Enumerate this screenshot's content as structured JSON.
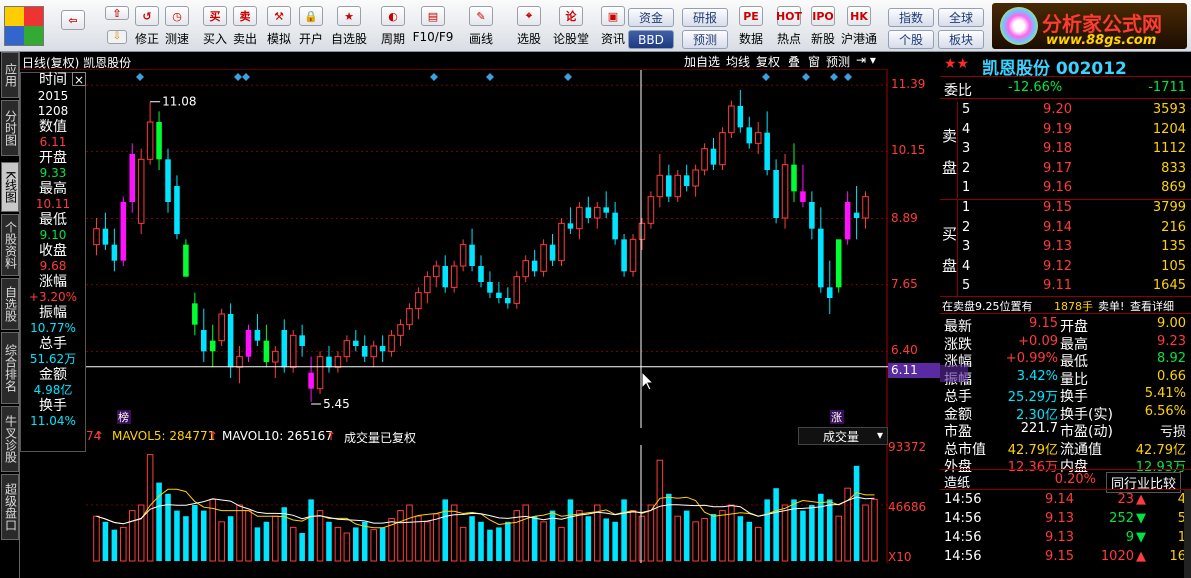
{
  "toolbar": {
    "buttons": [
      {
        "icon": "back-arrow-icon",
        "label": ""
      },
      {
        "icon": "up-arrow-icon",
        "label": ""
      },
      {
        "icon": "restore-icon",
        "label": "修正"
      },
      {
        "icon": "clock-icon",
        "label": "测速"
      },
      {
        "icon": "buy-icon",
        "label": "买入",
        "glyph": "买"
      },
      {
        "icon": "sell-icon",
        "label": "卖出",
        "glyph": "卖"
      },
      {
        "icon": "hammer-icon",
        "label": "模拟"
      },
      {
        "icon": "lock-icon",
        "label": "开户"
      },
      {
        "icon": "star-icon",
        "label": "自选股"
      },
      {
        "icon": "period-icon",
        "label": "周期"
      },
      {
        "icon": "f10-icon",
        "label": "F10/F9"
      },
      {
        "icon": "pen-icon",
        "label": "画线"
      },
      {
        "icon": "select-stock-icon",
        "label": "选股"
      },
      {
        "icon": "forum-icon",
        "label": "论股堂",
        "glyph": "论"
      },
      {
        "icon": "news-icon",
        "label": "资讯"
      },
      {
        "icon": "data-icon",
        "label": "数据",
        "glyph": "PE"
      },
      {
        "icon": "hot-icon",
        "label": "热点",
        "glyph": "HOT"
      },
      {
        "icon": "ipo-icon",
        "label": "新股",
        "glyph": "IPO"
      },
      {
        "icon": "hk-connect-icon",
        "label": "沪港通",
        "glyph": "HK"
      }
    ],
    "pills": [
      "资金",
      "研报",
      "指数",
      "全球",
      "BBD",
      "预测",
      "个股",
      "板块"
    ],
    "brand": {
      "title": "分析家公式网",
      "url": "www.88gs.com"
    }
  },
  "sidetabs": [
    "应用",
    "分时图",
    "K线图",
    "个股资料",
    "自选股",
    "综合排名",
    "牛叉诊股",
    "超级盘口"
  ],
  "chart": {
    "name": "日线(复权)  凯恩股份",
    "buttons": [
      "加自选",
      "均线",
      "复权",
      "叠",
      "窗",
      "预测"
    ],
    "high_label": "11.08",
    "low_label": "5.45",
    "cursor_price": "6.11",
    "axis": [
      "11.39",
      "10.15",
      "8.89",
      "7.65",
      "6.40"
    ],
    "marker_left": "榜",
    "marker_right": "涨"
  },
  "info": {
    "items": [
      {
        "label": "时间",
        "value": "2015",
        "color": "#ffffff"
      },
      {
        "label": "",
        "value": "1208",
        "color": "#ffffff"
      },
      {
        "label": "数值",
        "value": "6.11",
        "color": "#ff3b3b"
      },
      {
        "label": "开盘",
        "value": "9.33",
        "color": "#00e640"
      },
      {
        "label": "最高",
        "value": "10.11",
        "color": "#ff3b3b"
      },
      {
        "label": "最低",
        "value": "9.10",
        "color": "#00e640"
      },
      {
        "label": "收盘",
        "value": "9.68",
        "color": "#ff3b3b"
      },
      {
        "label": "涨幅",
        "value": "+3.20%",
        "color": "#ff3b3b"
      },
      {
        "label": "振幅",
        "value": "10.77%",
        "color": "#00e5ff"
      },
      {
        "label": "总手",
        "value": "51.62万",
        "color": "#00e5ff"
      },
      {
        "label": "金额",
        "value": "4.98亿",
        "color": "#00e5ff"
      },
      {
        "label": "换手",
        "value": "11.04%",
        "color": "#00e5ff"
      }
    ]
  },
  "volume": {
    "prefix": "74",
    "mavol5": "MAVOL5: 284771",
    "mavol10": "MAVOL10: 265167",
    "note": "成交量已复权",
    "selector": "成交量",
    "axis": [
      "93372",
      "46686"
    ],
    "unit": "X10"
  },
  "quote": {
    "title": "凯恩股份 002012",
    "wb": {
      "label": "委比",
      "pct": "-12.66%",
      "diff": "-1711"
    },
    "sell_label": "卖盘",
    "buy_label": "买盘",
    "sells": [
      {
        "n": "5",
        "p": "9.20",
        "v": "3593"
      },
      {
        "n": "4",
        "p": "9.19",
        "v": "1204"
      },
      {
        "n": "3",
        "p": "9.18",
        "v": "1112"
      },
      {
        "n": "2",
        "p": "9.17",
        "v": "833"
      },
      {
        "n": "1",
        "p": "9.16",
        "v": "869"
      }
    ],
    "buys": [
      {
        "n": "1",
        "p": "9.15",
        "v": "3799"
      },
      {
        "n": "2",
        "p": "9.14",
        "v": "216"
      },
      {
        "n": "3",
        "p": "9.13",
        "v": "135"
      },
      {
        "n": "4",
        "p": "9.12",
        "v": "105"
      },
      {
        "n": "5",
        "p": "9.11",
        "v": "1645"
      }
    ],
    "notice": {
      "text": "在卖盘9.25位置有",
      "qty": "1878手",
      "tag": "卖单!",
      "link": "查看详细"
    },
    "stats": [
      {
        "l1": "最新",
        "v1": "9.15",
        "c1": "#ff3b3b",
        "l2": "开盘",
        "v2": "9.00",
        "c2": "#ffd200"
      },
      {
        "l1": "涨跌",
        "v1": "+0.09",
        "c1": "#ff3b3b",
        "l2": "最高",
        "v2": "9.23",
        "c2": "#ff3b3b"
      },
      {
        "l1": "涨幅",
        "v1": "+0.99%",
        "c1": "#ff3b3b",
        "l2": "最低",
        "v2": "8.92",
        "c2": "#00e640"
      },
      {
        "l1": "振幅",
        "v1": "3.42%",
        "c1": "#00e5ff",
        "l2": "量比",
        "v2": "0.66",
        "c2": "#ffd200"
      },
      {
        "l1": "总手",
        "v1": "25.29万",
        "c1": "#00e5ff",
        "l2": "换手",
        "v2": "5.41%",
        "c2": "#ffd200"
      },
      {
        "l1": "金额",
        "v1": "2.30亿",
        "c1": "#00e5ff",
        "l2": "换手(实)",
        "v2": "6.56%",
        "c2": "#ffd200"
      },
      {
        "l1": "市盈",
        "v1": "221.7",
        "c1": "#ffffff",
        "l2": "市盈(动)",
        "v2": "亏损",
        "c2": "#ffffff"
      },
      {
        "l1": "总市值",
        "v1": "42.79亿",
        "c1": "#ffd200",
        "l2": "流通值",
        "v2": "42.79亿",
        "c2": "#ffd200"
      },
      {
        "l1": "外盘",
        "v1": "12.36万",
        "c1": "#ff3b3b",
        "l2": "内盘",
        "v2": "12.93万",
        "c2": "#00e640"
      }
    ],
    "industry": {
      "name": "造纸",
      "pct": "0.20%",
      "link": "同行业比较"
    },
    "ticks": [
      {
        "t": "14:56",
        "p": "9.14",
        "v": "23",
        "dir": "up",
        "n": "4"
      },
      {
        "t": "14:56",
        "p": "9.13",
        "v": "252",
        "dir": "down",
        "n": "5"
      },
      {
        "t": "14:56",
        "p": "9.13",
        "v": "9",
        "dir": "down",
        "n": "1"
      },
      {
        "t": "14:56",
        "p": "9.15",
        "v": "1020",
        "dir": "up",
        "n": "16"
      }
    ]
  },
  "colors": {
    "up": "#ff3b3b",
    "down": "#00e5ff",
    "bigup": "#ff10ff",
    "bigdown": "#00ff30",
    "grid": "#7a0000",
    "ma": "#ffffff",
    "ma2": "#ffd200"
  },
  "chart_data": {
    "type": "candlestick",
    "note": "daily K-line of 凯恩股份, approx price values (open, high, low, close)",
    "ylim": [
      5.0,
      11.6
    ],
    "candles": [
      [
        8.4,
        8.9,
        8.2,
        8.7
      ],
      [
        8.7,
        9.0,
        8.3,
        8.4
      ],
      [
        8.4,
        8.7,
        7.9,
        8.1
      ],
      [
        8.1,
        9.3,
        8.0,
        9.2
      ],
      [
        9.2,
        10.3,
        9.0,
        10.1
      ],
      [
        8.8,
        10.2,
        8.6,
        10.0
      ],
      [
        10.0,
        11.08,
        9.9,
        10.7
      ],
      [
        10.7,
        10.9,
        9.8,
        10.0
      ],
      [
        10.0,
        10.2,
        9.0,
        9.2
      ],
      [
        9.5,
        9.7,
        8.5,
        8.6
      ],
      [
        8.4,
        8.5,
        7.8,
        7.8
      ],
      [
        7.3,
        7.5,
        6.7,
        6.9
      ],
      [
        6.8,
        7.2,
        6.2,
        6.4
      ],
      [
        6.4,
        6.9,
        6.1,
        6.6
      ],
      [
        6.6,
        7.2,
        6.5,
        7.1
      ],
      [
        7.1,
        7.3,
        5.9,
        6.1
      ],
      [
        6.1,
        6.5,
        5.8,
        6.3
      ],
      [
        6.3,
        6.9,
        6.2,
        6.8
      ],
      [
        6.8,
        7.1,
        6.5,
        6.6
      ],
      [
        6.6,
        6.9,
        6.1,
        6.2
      ],
      [
        6.2,
        6.5,
        5.9,
        6.4
      ],
      [
        6.8,
        7.0,
        6.0,
        6.1
      ],
      [
        6.1,
        6.8,
        6.0,
        6.7
      ],
      [
        6.7,
        6.9,
        6.3,
        6.5
      ],
      [
        6.0,
        6.3,
        5.45,
        5.7
      ],
      [
        5.7,
        6.4,
        5.6,
        6.3
      ],
      [
        6.3,
        6.5,
        6.0,
        6.1
      ],
      [
        6.1,
        6.4,
        6.0,
        6.3
      ],
      [
        6.3,
        6.7,
        6.2,
        6.6
      ],
      [
        6.6,
        6.8,
        6.4,
        6.5
      ],
      [
        6.5,
        6.7,
        6.2,
        6.3
      ],
      [
        6.3,
        6.6,
        6.1,
        6.5
      ],
      [
        6.5,
        6.7,
        6.2,
        6.4
      ],
      [
        6.4,
        6.8,
        6.3,
        6.7
      ],
      [
        6.7,
        7.0,
        6.5,
        6.9
      ],
      [
        6.9,
        7.3,
        6.8,
        7.2
      ],
      [
        7.2,
        7.6,
        7.0,
        7.5
      ],
      [
        7.5,
        7.9,
        7.3,
        7.8
      ],
      [
        7.8,
        8.1,
        7.6,
        8.0
      ],
      [
        8.0,
        8.2,
        7.5,
        7.6
      ],
      [
        7.6,
        8.1,
        7.5,
        8.0
      ],
      [
        8.0,
        8.5,
        7.9,
        8.4
      ],
      [
        8.4,
        8.7,
        7.9,
        8.0
      ],
      [
        8.0,
        8.2,
        7.6,
        7.7
      ],
      [
        7.7,
        7.9,
        7.4,
        7.5
      ],
      [
        7.5,
        7.7,
        7.3,
        7.4
      ],
      [
        7.4,
        7.6,
        7.2,
        7.3
      ],
      [
        7.3,
        7.9,
        7.2,
        7.8
      ],
      [
        7.8,
        8.2,
        7.7,
        8.1
      ],
      [
        8.1,
        8.3,
        7.8,
        7.9
      ],
      [
        7.9,
        8.5,
        7.8,
        8.4
      ],
      [
        8.4,
        8.6,
        8.0,
        8.1
      ],
      [
        8.1,
        8.9,
        8.0,
        8.8
      ],
      [
        8.8,
        9.1,
        8.6,
        8.7
      ],
      [
        8.7,
        9.2,
        8.5,
        9.1
      ],
      [
        9.1,
        9.3,
        8.8,
        8.9
      ],
      [
        8.9,
        9.2,
        8.7,
        9.1
      ],
      [
        9.1,
        9.4,
        8.9,
        9.0
      ],
      [
        9.0,
        9.2,
        8.4,
        8.5
      ],
      [
        8.5,
        8.6,
        7.8,
        7.9
      ],
      [
        7.9,
        8.6,
        7.8,
        8.5
      ],
      [
        8.5,
        8.9,
        8.3,
        8.8
      ],
      [
        8.8,
        9.4,
        8.7,
        9.3
      ],
      [
        9.3,
        10.1,
        9.1,
        9.7
      ],
      [
        9.7,
        9.9,
        9.2,
        9.3
      ],
      [
        9.3,
        9.8,
        9.2,
        9.7
      ],
      [
        9.7,
        9.9,
        9.4,
        9.5
      ],
      [
        9.5,
        9.9,
        9.3,
        9.8
      ],
      [
        9.8,
        10.3,
        9.7,
        10.2
      ],
      [
        10.2,
        10.4,
        9.8,
        9.9
      ],
      [
        9.9,
        10.6,
        9.8,
        10.5
      ],
      [
        10.5,
        11.1,
        10.4,
        11.0
      ],
      [
        11.0,
        11.3,
        10.5,
        10.6
      ],
      [
        10.6,
        10.8,
        10.2,
        10.3
      ],
      [
        10.3,
        10.7,
        10.1,
        10.5
      ],
      [
        10.5,
        10.9,
        9.7,
        9.8
      ],
      [
        9.8,
        10.0,
        8.8,
        8.9
      ],
      [
        8.9,
        10.1,
        8.7,
        9.9
      ],
      [
        9.9,
        10.3,
        9.2,
        9.4
      ],
      [
        9.4,
        9.9,
        9.1,
        9.2
      ],
      [
        9.2,
        9.4,
        8.5,
        8.7
      ],
      [
        8.7,
        9.1,
        7.5,
        7.6
      ],
      [
        7.6,
        8.1,
        7.1,
        7.4
      ],
      [
        7.6,
        8.5,
        7.5,
        8.5
      ],
      [
        8.5,
        9.4,
        8.4,
        9.2
      ],
      [
        9.0,
        9.5,
        8.5,
        8.9
      ],
      [
        8.9,
        9.4,
        8.7,
        9.3
      ]
    ],
    "volumes": [
      40,
      35,
      28,
      30,
      45,
      50,
      95,
      70,
      60,
      45,
      40,
      50,
      45,
      55,
      35,
      40,
      50,
      45,
      30,
      35,
      40,
      48,
      30,
      25,
      55,
      45,
      35,
      30,
      25,
      30,
      35,
      28,
      30,
      38,
      45,
      50,
      40,
      35,
      42,
      55,
      50,
      30,
      40,
      35,
      28,
      30,
      35,
      45,
      50,
      40,
      35,
      45,
      30,
      55,
      45,
      40,
      50,
      38,
      35,
      55,
      45,
      40,
      50,
      90,
      60,
      40,
      45,
      35,
      38,
      42,
      45,
      50,
      40,
      35,
      30,
      55,
      65,
      50,
      55,
      45,
      50,
      60,
      55,
      40,
      65,
      85,
      50,
      55
    ],
    "ma_price": [
      8.6,
      8.6,
      8.5,
      8.5,
      8.6,
      8.8,
      9.1,
      9.2,
      9.1,
      8.9,
      8.6,
      8.2,
      7.8,
      7.4,
      7.1,
      6.8,
      6.6,
      6.6,
      6.6,
      6.5,
      6.4,
      6.4,
      6.4,
      6.4,
      6.3,
      6.2,
      6.2,
      6.2,
      6.3,
      6.4,
      6.4,
      6.4,
      6.4,
      6.5,
      6.6,
      6.7,
      6.9,
      7.1,
      7.3,
      7.4,
      7.6,
      7.8,
      7.9,
      7.9,
      7.8,
      7.7,
      7.6,
      7.5,
      7.5,
      7.6,
      7.7,
      7.9,
      8.1,
      8.3,
      8.5,
      8.7,
      8.8,
      8.9,
      8.8,
      8.6,
      8.5,
      8.5,
      8.6,
      8.8,
      9.0,
      9.2,
      9.4,
      9.5,
      9.6,
      9.8,
      10.0,
      10.2,
      10.4,
      10.5,
      10.6,
      10.5,
      10.3,
      10.1,
      9.9,
      9.6,
      9.3,
      8.9,
      8.6,
      8.5,
      8.5,
      8.5,
      8.6,
      8.7
    ]
  }
}
